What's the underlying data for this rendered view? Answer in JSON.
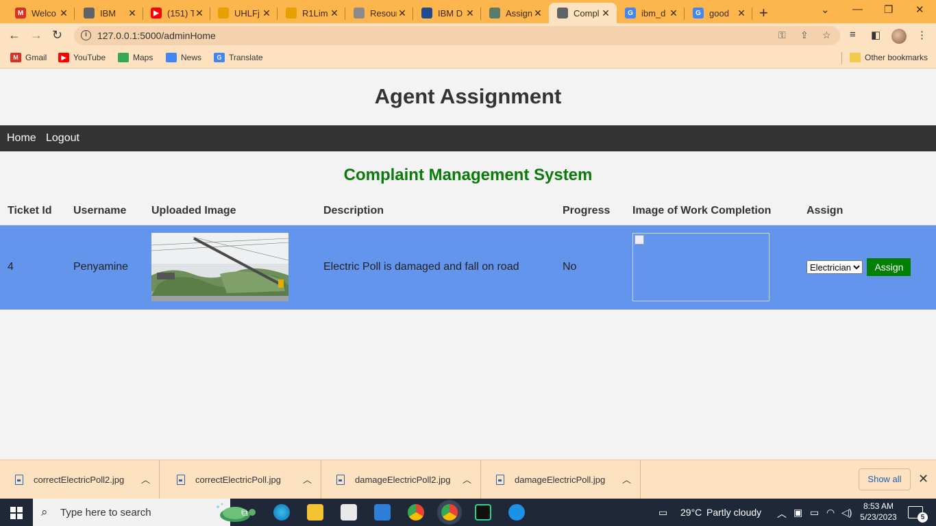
{
  "browser": {
    "tabs": [
      {
        "label": "Welco",
        "icon": "gmail-icon",
        "color": "#d93025",
        "glyph": "M"
      },
      {
        "label": "IBM",
        "icon": "globe-icon",
        "color": "#5f6368",
        "glyph": ""
      },
      {
        "label": "(151) T",
        "icon": "youtube-icon",
        "color": "#ff0000",
        "glyph": "▶"
      },
      {
        "label": "UHLFj",
        "icon": "drive-icon",
        "color": "#e8a000",
        "glyph": ""
      },
      {
        "label": "R1Lim",
        "icon": "drive-icon",
        "color": "#e8a000",
        "glyph": ""
      },
      {
        "label": "Resour",
        "icon": "cloud-icon",
        "color": "#8a8a8a",
        "glyph": ""
      },
      {
        "label": "IBM D",
        "icon": "ibm-icon",
        "color": "#1f4b8f",
        "glyph": ""
      },
      {
        "label": "Assign",
        "icon": "chatgpt-icon",
        "color": "#5a7a6a",
        "glyph": ""
      },
      {
        "label": "Compl",
        "icon": "globe-icon",
        "color": "#5f6368",
        "glyph": ""
      },
      {
        "label": "ibm_d",
        "icon": "google-icon",
        "color": "#4285f4",
        "glyph": "G"
      },
      {
        "label": "good",
        "icon": "google-icon",
        "color": "#4285f4",
        "glyph": "G"
      }
    ],
    "url": "127.0.0.1:5000/adminHome",
    "bookmarks": [
      {
        "label": "Gmail",
        "icon": "gmail-icon",
        "color": "#d93025",
        "glyph": "M"
      },
      {
        "label": "YouTube",
        "icon": "youtube-icon",
        "color": "#ff0000",
        "glyph": "▶"
      },
      {
        "label": "Maps",
        "icon": "maps-icon",
        "color": "#34a853",
        "glyph": ""
      },
      {
        "label": "News",
        "icon": "news-icon",
        "color": "#4285f4",
        "glyph": ""
      },
      {
        "label": "Translate",
        "icon": "translate-icon",
        "color": "#4285f4",
        "glyph": "G"
      }
    ],
    "other_bookmarks": "Other bookmarks"
  },
  "page": {
    "title": "Agent Assignment",
    "nav": [
      "Home",
      "Logout"
    ],
    "subtitle": "Complaint Management System",
    "table": {
      "headers": [
        "Ticket Id",
        "Username",
        "Uploaded Image",
        "Description",
        "Progress",
        "Image of Work Completion",
        "Assign"
      ],
      "rows": [
        {
          "ticket_id": "4",
          "username": "Penyamine",
          "description": "Electric Poll is damaged and fall on road",
          "progress": "No",
          "assign_selected": "Electrician",
          "assign_button": "Assign"
        }
      ]
    },
    "row_color": "#6495ed",
    "accent_green": "#008000"
  },
  "downloads": {
    "items": [
      "correctElectricPoll2.jpg",
      "correctElectricPoll.jpg",
      "damageElectricPoll2.jpg",
      "damageElectricPoll.jpg"
    ],
    "show_all": "Show all"
  },
  "taskbar": {
    "search_placeholder": "Type here to search",
    "weather_temp": "29°C",
    "weather_text": "Partly cloudy",
    "time": "8:53 AM",
    "date": "5/23/2023",
    "notification_count": "5"
  }
}
